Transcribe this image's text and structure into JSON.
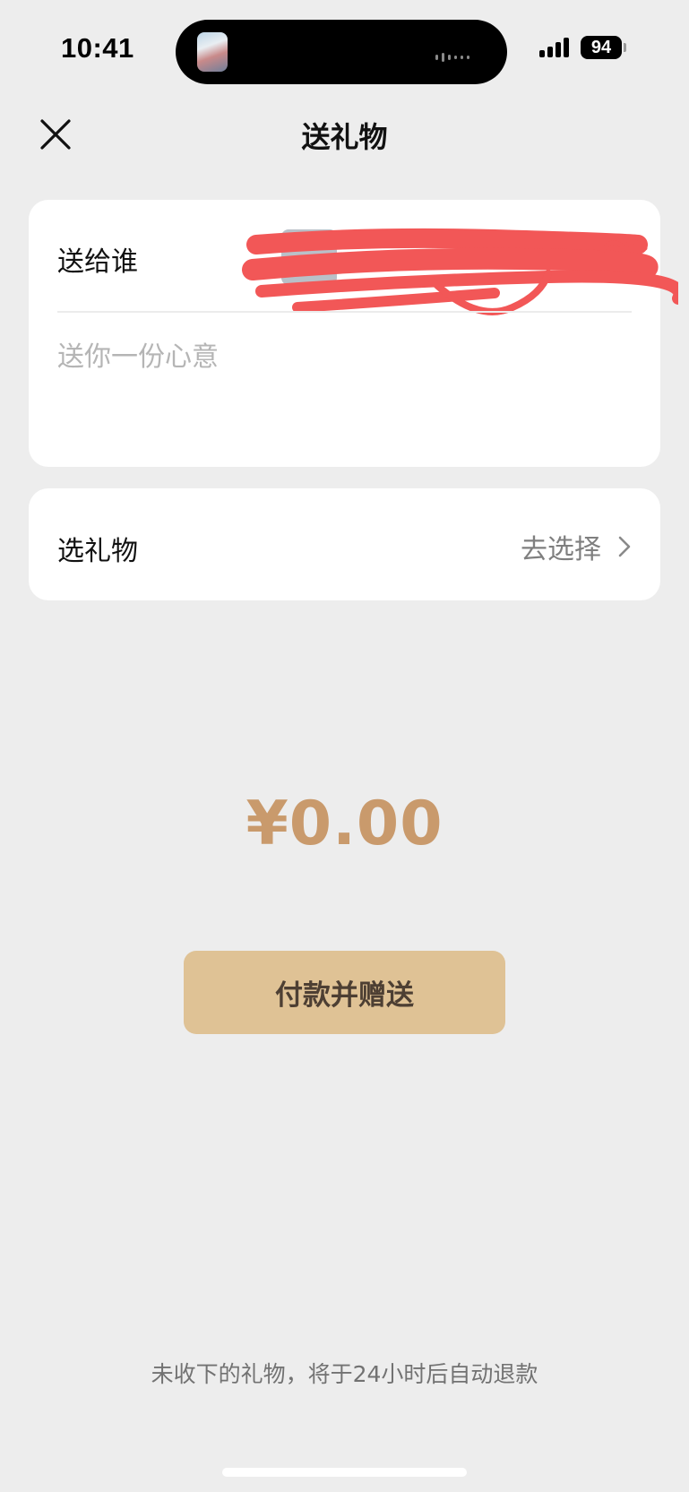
{
  "status_bar": {
    "time": "10:41",
    "battery": "94",
    "signal_icon": "cellular-signal-icon",
    "battery_icon": "battery-icon"
  },
  "nav": {
    "title": "送礼物",
    "close_icon": "close-icon"
  },
  "recipient": {
    "label": "送给谁",
    "message_placeholder": "送你一份心意",
    "message_value": ""
  },
  "gift": {
    "label": "选礼物",
    "action": "去选择",
    "action_icon": "chevron-right-icon"
  },
  "amount": "¥0.00",
  "pay_button": "付款并赠送",
  "footnote": "未收下的礼物，将于24小时后自动退款",
  "colors": {
    "background": "#ededed",
    "amount": "#c99a6c",
    "button": "#dfc295",
    "button_text": "#4d3f33",
    "redaction": "#f25757"
  }
}
